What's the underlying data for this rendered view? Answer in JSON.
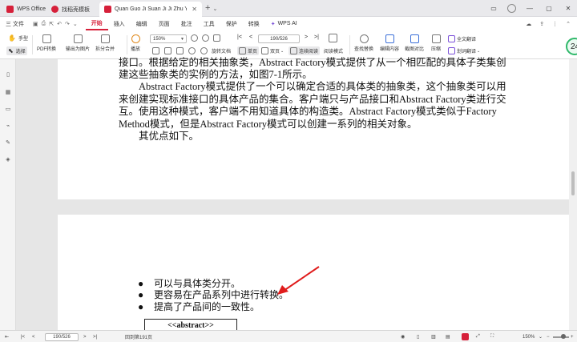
{
  "tabs": [
    {
      "label": "WPS Office",
      "color": "#d6203a"
    },
    {
      "label": "找稻壳模板",
      "color": "#d6203a"
    },
    {
      "label": "Quan Guo Ji Suan Ji Ji Zhu Yu R",
      "color": "#d6203a",
      "active": true
    }
  ],
  "menu": {
    "file_label": "三 文件",
    "items": [
      "开始",
      "插入",
      "编辑",
      "页面",
      "批注",
      "工具",
      "保护",
      "转换"
    ],
    "active_index": 0,
    "ai_label": "WPS AI"
  },
  "ribbon": {
    "hand": "手型",
    "select": "选择",
    "pdf_convert": "PDF转换",
    "export_image": "输出为图片",
    "split_merge": "拆分合并",
    "play": "播放",
    "zoom": "150%",
    "page": "190/526",
    "rotate": "旋转文档",
    "single": "单页",
    "double": "双页",
    "continuous": "连续阅读",
    "read_mode": "阅读模式",
    "find_replace": "查找替换",
    "edit_content": "编辑内容",
    "screenshot_compare": "截图对比",
    "compress": "压缩",
    "full_translate": "全文翻译",
    "word_translate": "划词翻译",
    "badge": "24"
  },
  "page1": {
    "lines": [
      "接口。根据给定的相关抽象类，Abstract Factory模式提供了从一个相匹配的具体子类集创",
      "建这些抽象类的实例的方法，如图7-1所示。",
      "　　Abstract Factory模式提供了一个可以确定合适的具体类的抽象类，这个抽象类可以用",
      "来创建实现标准接口的具体产品的集合。客户端只与产品接口和Abstract Factory类进行交",
      "互。使用这种模式，客户端不用知道具体的构造类。Abstract Factory模式类似于Factory",
      "Method模式，但是Abstract Factory模式可以创建一系列的相关对象。",
      "　　其优点如下。"
    ]
  },
  "page2": {
    "bullets": [
      "可以与具体类分开。",
      "更容易在产品系列中进行转换。",
      "提高了产品间的一致性。"
    ],
    "uml_label": "<<abstract>>"
  },
  "status": {
    "page": "190/526",
    "back_to": "回到第191页",
    "zoom": "150%"
  },
  "colors": {
    "accent": "#d6203a",
    "annotation_arrow": "#e01c1c"
  }
}
